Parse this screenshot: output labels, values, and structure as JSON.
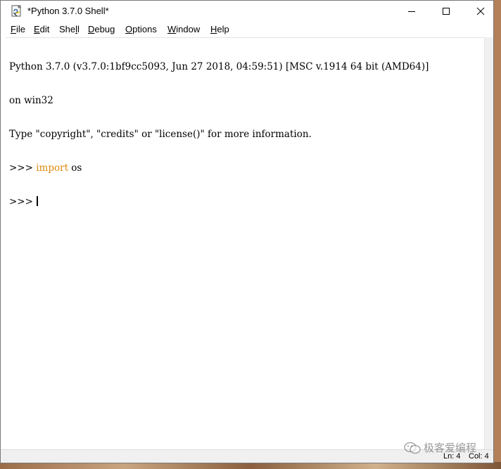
{
  "window": {
    "title": "*Python 3.7.0 Shell*"
  },
  "menu": {
    "items": [
      {
        "id": "file",
        "pre": "",
        "ul": "F",
        "post": "ile"
      },
      {
        "id": "edit",
        "pre": "",
        "ul": "E",
        "post": "dit"
      },
      {
        "id": "shell",
        "pre": "She",
        "ul": "l",
        "post": "l"
      },
      {
        "id": "debug",
        "pre": "",
        "ul": "D",
        "post": "ebug"
      },
      {
        "id": "options",
        "pre": "",
        "ul": "O",
        "post": "ptions"
      },
      {
        "id": "window",
        "pre": "",
        "ul": "W",
        "post": "indow"
      },
      {
        "id": "help",
        "pre": "",
        "ul": "H",
        "post": "elp"
      }
    ]
  },
  "shell": {
    "banner_line1": "Python 3.7.0 (v3.7.0:1bf9cc5093, Jun 27 2018, 04:59:51) [MSC v.1914 64 bit (AMD64)]",
    "banner_line2": "on win32",
    "banner_line3": "Type \"copyright\", \"credits\" or \"license()\" for more information.",
    "prompt": ">>> ",
    "cmd1_keyword": "import",
    "cmd1_rest": " os"
  },
  "status": {
    "ln": "Ln: 4",
    "col": "Col: 4"
  },
  "watermark": {
    "text": "极客爱编程"
  },
  "colors": {
    "keyword": "#e08a0b",
    "window_bg": "#ffffff",
    "statusbar_bg": "#f0f0f0"
  }
}
